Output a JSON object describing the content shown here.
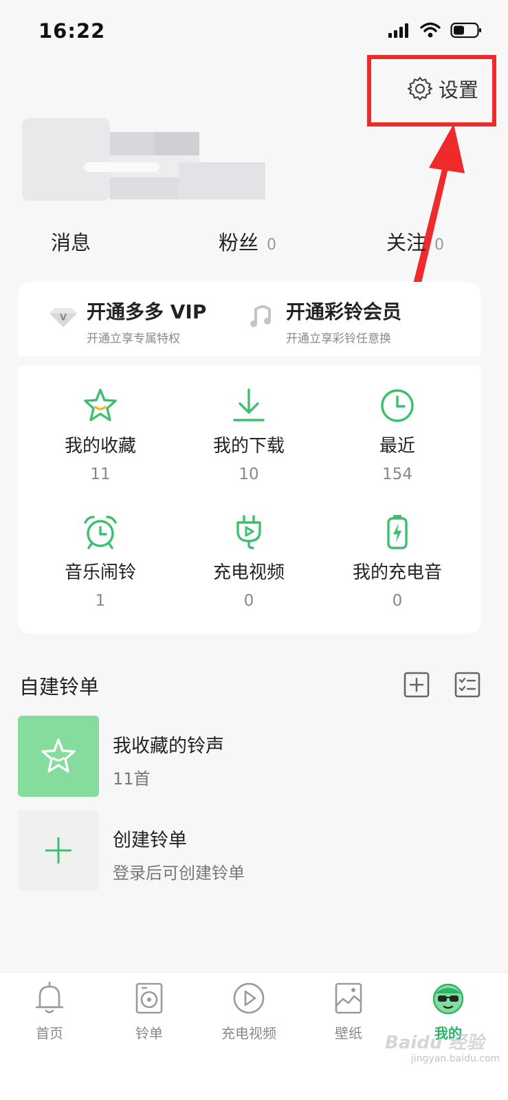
{
  "status_bar": {
    "time": "16:22",
    "icons": [
      "signal-icon",
      "wifi-icon",
      "battery-icon"
    ]
  },
  "header": {
    "settings_label": "设置",
    "settings_icon": "gear-icon"
  },
  "stats": [
    {
      "label": "消息",
      "count": ""
    },
    {
      "label": "粉丝",
      "count": "0"
    },
    {
      "label": "关注",
      "count": "0"
    }
  ],
  "vip": [
    {
      "title": "开通多多 VIP",
      "subtitle": "开通立享专属特权",
      "icon": "diamond-v-icon"
    },
    {
      "title": "开通彩铃会员",
      "subtitle": "开通立享彩铃任意换",
      "icon": "music-note-icon"
    }
  ],
  "grid": [
    {
      "label": "我的收藏",
      "count": "11",
      "icon": "star-icon"
    },
    {
      "label": "我的下载",
      "count": "10",
      "icon": "download-icon"
    },
    {
      "label": "最近",
      "count": "154",
      "icon": "clock-icon"
    },
    {
      "label": "音乐闹铃",
      "count": "1",
      "icon": "alarm-clock-icon"
    },
    {
      "label": "充电视频",
      "count": "0",
      "icon": "charging-plug-icon"
    },
    {
      "label": "我的充电音",
      "count": "0",
      "icon": "battery-charge-icon"
    }
  ],
  "playlists": {
    "title": "自建铃单",
    "actions": [
      "add-box-icon",
      "checklist-icon"
    ],
    "items": [
      {
        "title": "我收藏的铃声",
        "subtitle": "11首",
        "icon": "star-face-icon"
      },
      {
        "title": "创建铃单",
        "subtitle": "登录后可创建铃单",
        "icon": "plus-icon"
      }
    ]
  },
  "tabs": [
    {
      "label": "首页",
      "icon": "bell-icon"
    },
    {
      "label": "铃单",
      "icon": "vinyl-icon"
    },
    {
      "label": "充电视频",
      "icon": "play-circle-icon"
    },
    {
      "label": "壁纸",
      "icon": "image-icon"
    },
    {
      "label": "我的",
      "icon": "avatar-sunglasses-icon",
      "active": true
    }
  ],
  "watermark": {
    "text": "Baidu 经验",
    "subtext": "jingyan.baidu.com"
  },
  "colors": {
    "accent": "#2db36b",
    "accent_light": "#86dc9c",
    "annotation": "#ee2a2a",
    "background": "#f7f7f7"
  }
}
